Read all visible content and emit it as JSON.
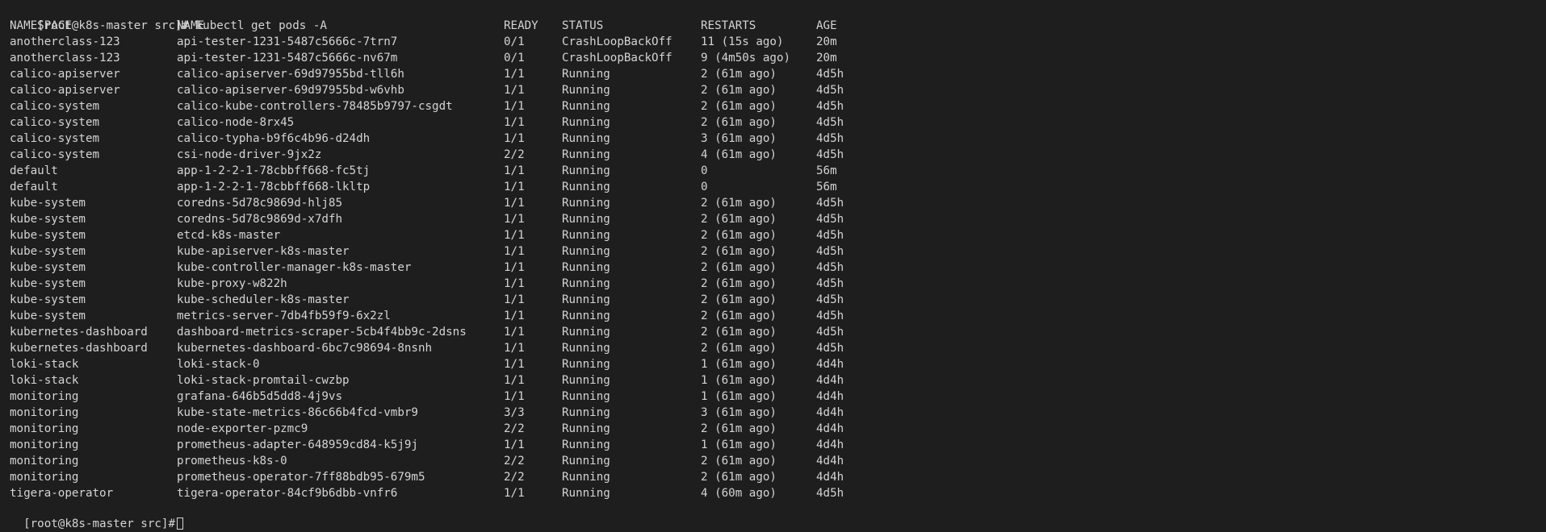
{
  "prompt": "[root@k8s-master src]#",
  "command": "kubectl get pods -A",
  "headers": {
    "namespace": "NAMESPACE",
    "name": "NAME",
    "ready": "READY",
    "status": "STATUS",
    "restarts": "RESTARTS",
    "age": "AGE"
  },
  "rows": [
    [
      "anotherclass-123",
      "api-tester-1231-5487c5666c-7trn7",
      "0/1",
      "CrashLoopBackOff",
      "11 (15s ago)",
      "20m"
    ],
    [
      "anotherclass-123",
      "api-tester-1231-5487c5666c-nv67m",
      "0/1",
      "CrashLoopBackOff",
      "9 (4m50s ago)",
      "20m"
    ],
    [
      "calico-apiserver",
      "calico-apiserver-69d97955bd-tll6h",
      "1/1",
      "Running",
      "2 (61m ago)",
      "4d5h"
    ],
    [
      "calico-apiserver",
      "calico-apiserver-69d97955bd-w6vhb",
      "1/1",
      "Running",
      "2 (61m ago)",
      "4d5h"
    ],
    [
      "calico-system",
      "calico-kube-controllers-78485b9797-csgdt",
      "1/1",
      "Running",
      "2 (61m ago)",
      "4d5h"
    ],
    [
      "calico-system",
      "calico-node-8rx45",
      "1/1",
      "Running",
      "2 (61m ago)",
      "4d5h"
    ],
    [
      "calico-system",
      "calico-typha-b9f6c4b96-d24dh",
      "1/1",
      "Running",
      "3 (61m ago)",
      "4d5h"
    ],
    [
      "calico-system",
      "csi-node-driver-9jx2z",
      "2/2",
      "Running",
      "4 (61m ago)",
      "4d5h"
    ],
    [
      "default",
      "app-1-2-2-1-78cbbff668-fc5tj",
      "1/1",
      "Running",
      "0",
      "56m"
    ],
    [
      "default",
      "app-1-2-2-1-78cbbff668-lkltp",
      "1/1",
      "Running",
      "0",
      "56m"
    ],
    [
      "kube-system",
      "coredns-5d78c9869d-hlj85",
      "1/1",
      "Running",
      "2 (61m ago)",
      "4d5h"
    ],
    [
      "kube-system",
      "coredns-5d78c9869d-x7dfh",
      "1/1",
      "Running",
      "2 (61m ago)",
      "4d5h"
    ],
    [
      "kube-system",
      "etcd-k8s-master",
      "1/1",
      "Running",
      "2 (61m ago)",
      "4d5h"
    ],
    [
      "kube-system",
      "kube-apiserver-k8s-master",
      "1/1",
      "Running",
      "2 (61m ago)",
      "4d5h"
    ],
    [
      "kube-system",
      "kube-controller-manager-k8s-master",
      "1/1",
      "Running",
      "2 (61m ago)",
      "4d5h"
    ],
    [
      "kube-system",
      "kube-proxy-w822h",
      "1/1",
      "Running",
      "2 (61m ago)",
      "4d5h"
    ],
    [
      "kube-system",
      "kube-scheduler-k8s-master",
      "1/1",
      "Running",
      "2 (61m ago)",
      "4d5h"
    ],
    [
      "kube-system",
      "metrics-server-7db4fb59f9-6x2zl",
      "1/1",
      "Running",
      "2 (61m ago)",
      "4d5h"
    ],
    [
      "kubernetes-dashboard",
      "dashboard-metrics-scraper-5cb4f4bb9c-2dsns",
      "1/1",
      "Running",
      "2 (61m ago)",
      "4d5h"
    ],
    [
      "kubernetes-dashboard",
      "kubernetes-dashboard-6bc7c98694-8nsnh",
      "1/1",
      "Running",
      "2 (61m ago)",
      "4d5h"
    ],
    [
      "loki-stack",
      "loki-stack-0",
      "1/1",
      "Running",
      "1 (61m ago)",
      "4d4h"
    ],
    [
      "loki-stack",
      "loki-stack-promtail-cwzbp",
      "1/1",
      "Running",
      "1 (61m ago)",
      "4d4h"
    ],
    [
      "monitoring",
      "grafana-646b5d5dd8-4j9vs",
      "1/1",
      "Running",
      "1 (61m ago)",
      "4d4h"
    ],
    [
      "monitoring",
      "kube-state-metrics-86c66b4fcd-vmbr9",
      "3/3",
      "Running",
      "3 (61m ago)",
      "4d4h"
    ],
    [
      "monitoring",
      "node-exporter-pzmc9",
      "2/2",
      "Running",
      "2 (61m ago)",
      "4d4h"
    ],
    [
      "monitoring",
      "prometheus-adapter-648959cd84-k5j9j",
      "1/1",
      "Running",
      "1 (61m ago)",
      "4d4h"
    ],
    [
      "monitoring",
      "prometheus-k8s-0",
      "2/2",
      "Running",
      "2 (61m ago)",
      "4d4h"
    ],
    [
      "monitoring",
      "prometheus-operator-7ff88bdb95-679m5",
      "2/2",
      "Running",
      "2 (61m ago)",
      "4d4h"
    ],
    [
      "tigera-operator",
      "tigera-operator-84cf9b6dbb-vnfr6",
      "1/1",
      "Running",
      "4 (60m ago)",
      "4d5h"
    ]
  ],
  "final_prompt": "[root@k8s-master src]#"
}
